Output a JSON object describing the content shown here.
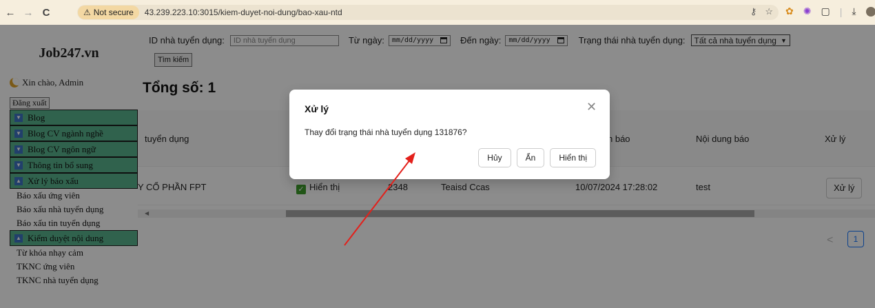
{
  "browser": {
    "back_glyph": "←",
    "forward_glyph": "→",
    "reload_glyph": "C",
    "security_label": "Not secure",
    "url": "43.239.223.10:3015/kiem-duyet-noi-dung/bao-xau-ntd"
  },
  "sidebar": {
    "brand": "Job247.vn",
    "greeting": "Xin chào, Admin",
    "logout_label": "Đăng xuất",
    "menu": [
      {
        "label": "Blog",
        "expanded": false
      },
      {
        "label": "Blog CV ngành nghề",
        "expanded": false
      },
      {
        "label": "Blog CV ngôn ngữ",
        "expanded": false
      },
      {
        "label": "Thông tin bổ sung",
        "expanded": false
      },
      {
        "label": "Xử lý báo xấu",
        "expanded": true,
        "children": [
          "Báo xấu ứng viên",
          "Báo xấu nhà tuyển dụng",
          "Báo xấu tin tuyển dụng"
        ]
      },
      {
        "label": "Kiểm duyệt nội dung",
        "expanded": true,
        "children": [
          "Từ khóa nhạy cảm",
          "TKNC ứng viên",
          "TKNC nhà tuyển dụng"
        ]
      }
    ]
  },
  "filters": {
    "employer_id_label": "ID nhà tuyển dụng:",
    "employer_id_placeholder": "ID nhà tuyển dụng",
    "from_label": "Từ ngày:",
    "to_label": "Đến ngày:",
    "date_placeholder": "mm/dd/yyyy",
    "status_label": "Trạng thái nhà tuyển dụng:",
    "status_value": "Tất cả nhà tuyển dụng",
    "search_label": "Tìm kiếm"
  },
  "summary": {
    "total": "Tổng số: 1"
  },
  "table": {
    "headers": {
      "employer": "tuyển dụng",
      "report_time": "h báo",
      "report_content": "Nội dung báo",
      "action": "Xử lý"
    },
    "row": {
      "employer": "Y CỔ PHẦN FPT",
      "status": "Hiển thị",
      "id": "2348",
      "reporter": "Teaisd Ccas",
      "time": "10/07/2024 17:28:02",
      "content": "test",
      "action_label": "Xử lý"
    }
  },
  "pagination": {
    "prev_glyph": "<",
    "current_page": "1"
  },
  "modal": {
    "title": "Xử lý",
    "message": "Thay đổi trạng thái nhà tuyển dụng 131876?",
    "close_glyph": "✕",
    "buttons": {
      "cancel": "Hủy",
      "hide": "Ẩn",
      "show": "Hiển thị"
    }
  },
  "colors": {
    "menu_header_bg": "#58b38c",
    "arrow": "#e3201b",
    "primary": "#1677ff",
    "status_check": "#3f9e2d"
  }
}
